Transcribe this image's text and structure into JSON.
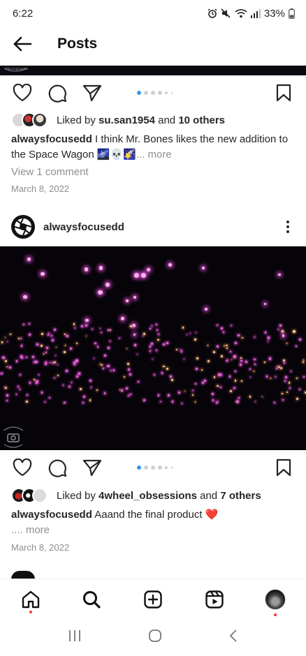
{
  "status_bar": {
    "time": "6:22",
    "battery_percent": "33%",
    "icons": [
      "alarm-icon",
      "mute-icon",
      "wifi-icon",
      "signal-icon",
      "battery-icon"
    ]
  },
  "app_bar": {
    "title": "Posts",
    "back_icon": "arrow-left-icon"
  },
  "posts": [
    {
      "liked_by_prefix": "Liked by ",
      "liked_by_user": "su.san1954",
      "and_text": " and ",
      "others": "10 others",
      "username": "alwaysfocusedd",
      "caption": " I think Mr. Bones likes the new addition to the Space Wagon 🌌💀🌠",
      "more": "... more",
      "view_comments": "View 1 comment",
      "date": "March 8, 2022",
      "carousel": {
        "count": 6,
        "active_index": 0
      }
    },
    {
      "author": "alwaysfocusedd",
      "liked_by_prefix": "Liked by ",
      "liked_by_user": "4wheel_obsessions",
      "and_text": " and ",
      "others": "7 others",
      "username": "alwaysfocusedd",
      "caption": " Aaand the final product ❤️",
      "more": ".... more",
      "date": "March 8, 2022",
      "carousel": {
        "count": 6,
        "active_index": 0
      }
    }
  ],
  "bottom_nav": [
    "home-icon",
    "search-icon",
    "create-icon",
    "reels-icon",
    "profile-avatar"
  ],
  "colors": {
    "accent_blue": "#3897f0",
    "heart_red": "#ed4956",
    "star_pink": "#e94bd6",
    "notification_dot": "#ff3040"
  }
}
